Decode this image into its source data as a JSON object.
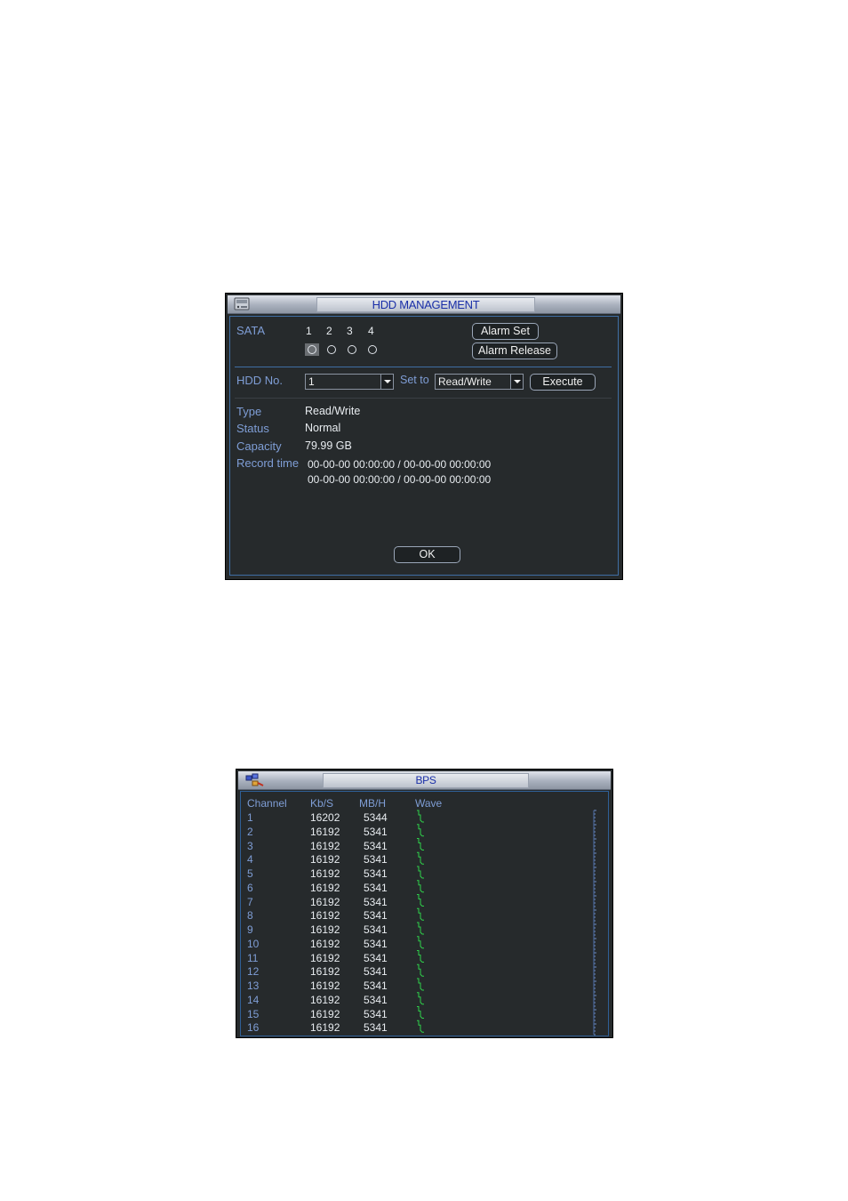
{
  "hdd": {
    "title": "HDD MANAGEMENT",
    "sata_label": "SATA",
    "sata_ports": [
      "1",
      "2",
      "3",
      "4"
    ],
    "alarm_set": "Alarm Set",
    "alarm_release": "Alarm Release",
    "hdd_no_label": "HDD No.",
    "hdd_no_value": "1",
    "set_to_label": "Set to",
    "set_to_value": "Read/Write",
    "execute": "Execute",
    "type_label": "Type",
    "type_value": "Read/Write",
    "status_label": "Status",
    "status_value": "Normal",
    "capacity_label": "Capacity",
    "capacity_value": "79.99 GB",
    "record_time_label": "Record time",
    "record_time_1": "00-00-00 00:00:00 / 00-00-00 00:00:00",
    "record_time_2": "00-00-00 00:00:00 / 00-00-00 00:00:00",
    "ok": "OK"
  },
  "bps": {
    "title": "BPS",
    "headers": {
      "channel": "Channel",
      "kbs": "Kb/S",
      "mbh": "MB/H",
      "wave": "Wave"
    },
    "rows": [
      {
        "channel": "1",
        "kbs": "16202",
        "mbh": "5344"
      },
      {
        "channel": "2",
        "kbs": "16192",
        "mbh": "5341"
      },
      {
        "channel": "3",
        "kbs": "16192",
        "mbh": "5341"
      },
      {
        "channel": "4",
        "kbs": "16192",
        "mbh": "5341"
      },
      {
        "channel": "5",
        "kbs": "16192",
        "mbh": "5341"
      },
      {
        "channel": "6",
        "kbs": "16192",
        "mbh": "5341"
      },
      {
        "channel": "7",
        "kbs": "16192",
        "mbh": "5341"
      },
      {
        "channel": "8",
        "kbs": "16192",
        "mbh": "5341"
      },
      {
        "channel": "9",
        "kbs": "16192",
        "mbh": "5341"
      },
      {
        "channel": "10",
        "kbs": "16192",
        "mbh": "5341"
      },
      {
        "channel": "11",
        "kbs": "16192",
        "mbh": "5341"
      },
      {
        "channel": "12",
        "kbs": "16192",
        "mbh": "5341"
      },
      {
        "channel": "13",
        "kbs": "16192",
        "mbh": "5341"
      },
      {
        "channel": "14",
        "kbs": "16192",
        "mbh": "5341"
      },
      {
        "channel": "15",
        "kbs": "16192",
        "mbh": "5341"
      },
      {
        "channel": "16",
        "kbs": "16192",
        "mbh": "5341"
      }
    ]
  },
  "colors": {
    "panel_bg": "#262a2c",
    "label": "#7f9ed6",
    "accent_line": "#3f6ea4",
    "wave": "#2ed04a",
    "title_text": "#1a2fa8"
  },
  "icons": {
    "hdd_title": "hdd-icon",
    "bps_title": "network-icon"
  }
}
